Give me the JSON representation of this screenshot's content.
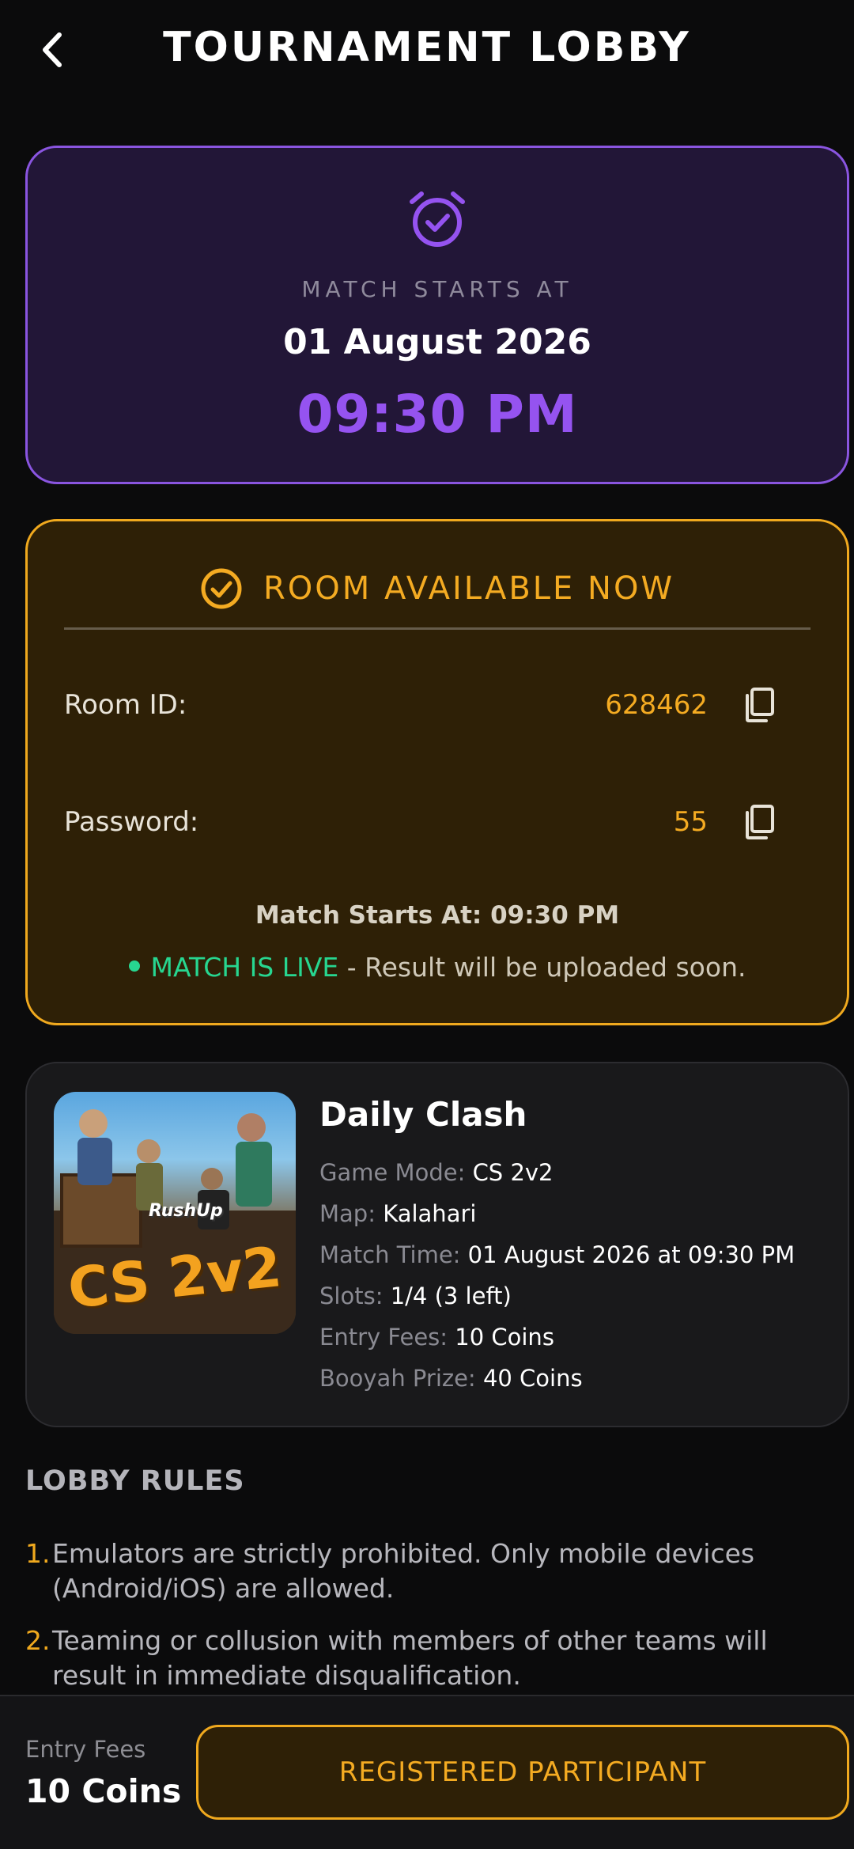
{
  "header": {
    "title": "TOURNAMENT LOBBY",
    "back_icon": "chevron-left-icon"
  },
  "match_start": {
    "icon": "alarm-check-icon",
    "label": "MATCH STARTS AT",
    "date": "01 August 2026",
    "time": "09:30 PM",
    "accent": "#9553f0"
  },
  "room": {
    "icon": "check-circle-icon",
    "heading": "ROOM AVAILABLE NOW",
    "room_id_label": "Room ID:",
    "room_id": "628462",
    "password_label": "Password:",
    "password": "55",
    "copy_icon": "copy-icon",
    "starts_at": "Match Starts At: 09:30 PM",
    "live_label": "MATCH IS LIVE",
    "live_note": " - Result will be uploaded soon.",
    "accent": "#f4ab22",
    "live_color": "#27d690"
  },
  "tournament": {
    "thumbnail_brand": "RushUp",
    "thumbnail_title": "CS 2v2",
    "name": "Daily Clash",
    "details": [
      {
        "key": "Game Mode:",
        "value": "CS 2v2"
      },
      {
        "key": "Map:",
        "value": "Kalahari"
      },
      {
        "key": "Match Time:",
        "value": "01 August 2026 at 09:30 PM"
      },
      {
        "key": "Slots:",
        "value": "1/4 (3 left)"
      },
      {
        "key": "Entry Fees:",
        "value": "10 Coins"
      },
      {
        "key": "Booyah Prize:",
        "value": "40 Coins"
      }
    ]
  },
  "rules": {
    "title": "LOBBY RULES",
    "items": [
      {
        "num": "1.",
        "text": "Emulators are strictly prohibited. Only mobile devices (Android/iOS) are allowed."
      },
      {
        "num": "2.",
        "text": "Teaming or collusion with members of other teams will result in immediate disqualification."
      }
    ]
  },
  "footer": {
    "fee_label": "Entry Fees",
    "fee_value": "10 Coins",
    "button_label": "REGISTERED PARTICIPANT"
  }
}
